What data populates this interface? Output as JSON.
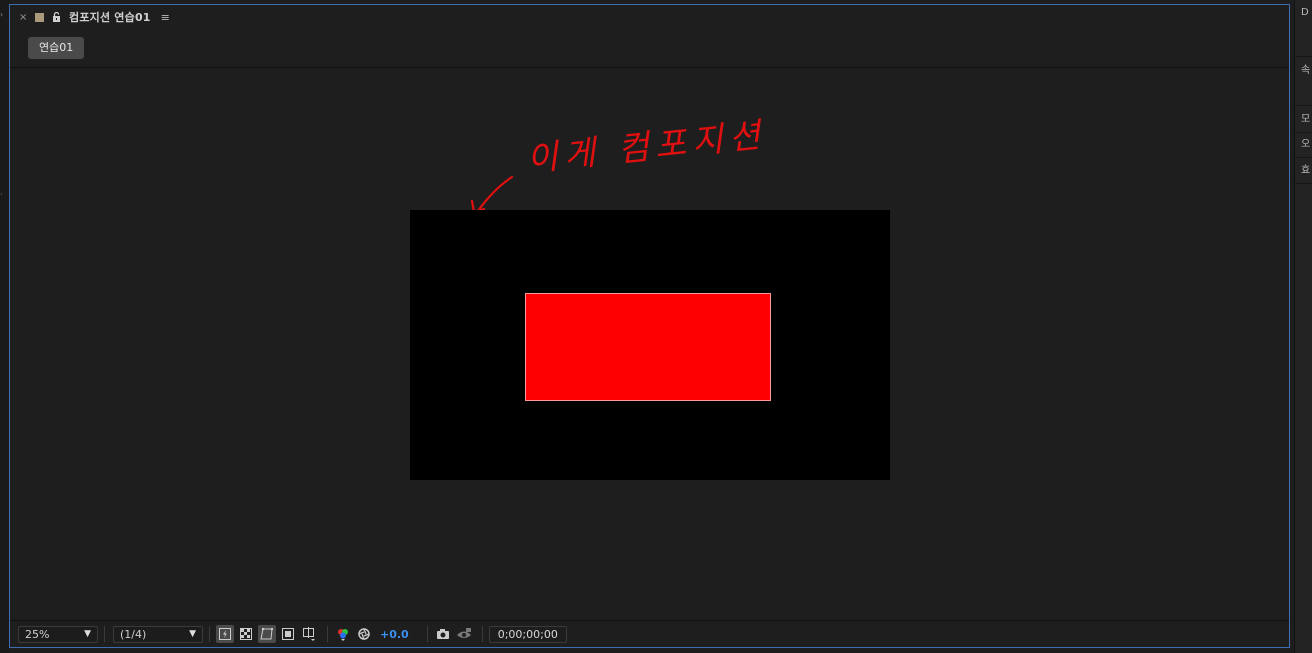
{
  "panel": {
    "title": "컴포지션 연습01",
    "close_icon": "×",
    "menu_icon": "≡"
  },
  "breadcrumb": {
    "label": "연습01"
  },
  "annotation": {
    "handwriting": "이게 컴포지션",
    "color": "#e01010"
  },
  "composition": {
    "background": "#000000",
    "layer_color": "#ff0000"
  },
  "toolbar": {
    "zoom": "25%",
    "resolution": "(1/4)",
    "exposure": "+0.0",
    "timecode": "0;00;00;00"
  },
  "right_panel": {
    "items": [
      "D",
      "속",
      "모",
      "오",
      "효"
    ]
  },
  "colors": {
    "panel_border": "#3f6db4",
    "exposure_text": "#3a8ff0"
  }
}
